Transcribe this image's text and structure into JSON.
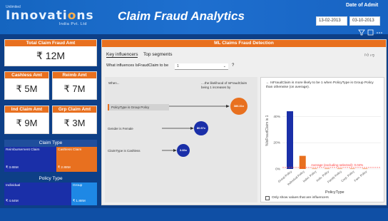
{
  "header": {
    "logo": {
      "top": "Unlimited",
      "main_a": "Innovati",
      "main_accent": "o",
      "main_b": "ns",
      "sub": "India Pvt. Ltd"
    },
    "title": "Claim Fraud Analytics",
    "date_filter": {
      "label": "Date of Admit",
      "start": "13-02-2013",
      "end": "03-10-2013"
    }
  },
  "kpis": {
    "total": {
      "label": "Total Claim Fraud Amt",
      "value": "₹ 12M"
    },
    "cashless": {
      "label": "Cashless Amt",
      "value": "₹ 5M"
    },
    "reimb": {
      "label": "Reimb Amt",
      "value": "₹ 7M"
    },
    "ind": {
      "label": "Ind Claim Amt",
      "value": "₹ 9M"
    },
    "grp": {
      "label": "Grp Claim Amt",
      "value": "₹ 3M"
    }
  },
  "claim_type": {
    "title": "Claim Type",
    "segments": [
      {
        "name": "Reimbursement Claim",
        "value": "₹ 3.65M",
        "share": 0.56
      },
      {
        "name": "Cashless Claim",
        "value": "₹ 2.88M",
        "share": 0.44
      }
    ]
  },
  "policy_type": {
    "title": "Policy Type",
    "segments": [
      {
        "name": "Individual",
        "value": "₹ 4.64M",
        "share": 0.72
      },
      {
        "name": "Group",
        "value": "₹ 1.88M",
        "share": 0.28
      }
    ]
  },
  "detection": {
    "title": "ML Claims Fraud Detection",
    "tabs": [
      "Key influencers",
      "Top segments"
    ],
    "question_prefix": "What influences IsFraudClaim to be",
    "question_value": "1",
    "question_suffix": "?",
    "col_when": "When...",
    "col_likelihood": "....the likelihood of IsFraudClaim being 1 increases by",
    "influencers": [
      {
        "label": "PolicyType is Group Policy",
        "value": "386.31x",
        "selected": true,
        "color": "#e8701f"
      },
      {
        "label": "Gender is Female",
        "value": "80.97x",
        "selected": false,
        "color": "#1a2fa8"
      },
      {
        "label": "ClaimType is Cashless",
        "value": "3.83x",
        "selected": false,
        "color": "#1a2fa8"
      }
    ],
    "detail_text": "IsFraudClaim is more likely to be 1 when PolicyType is Group Policy than otherwise (on average).",
    "checkbox_label": "Only show values that are influencers"
  },
  "chart_data": {
    "type": "bar",
    "xlabel": "PolicyType",
    "ylabel": "%IsFraudClaim is 1",
    "ylim": [
      0,
      50
    ],
    "yticks": [
      "0%",
      "20%",
      "40%"
    ],
    "categories": [
      "Group Policy",
      "Individual Policy",
      "Indivi. Policy",
      "Indiv. Policy",
      "Family Policy",
      "Corp. Policy",
      "Fam. Policy"
    ],
    "values": [
      44,
      10,
      0.3,
      0.3,
      0.3,
      0.3,
      0.3
    ],
    "bar_colors": [
      "#1a2fa8",
      "#e8701f",
      "#e8701f",
      "#e8701f",
      "#e8701f",
      "#e8701f",
      "#e8701f"
    ],
    "reference": {
      "label": "Average (excluding selected): 0.04%",
      "value": 0.04,
      "color": "#ff3b3b"
    }
  }
}
